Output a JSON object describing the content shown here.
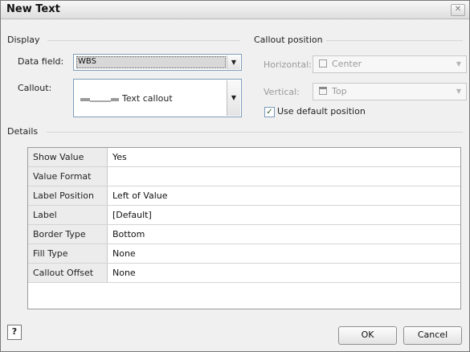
{
  "window": {
    "title": "New Text",
    "close_glyph": "✕"
  },
  "display": {
    "section_label": "Display",
    "data_field_label": "Data field:",
    "data_field_value": "WBS",
    "callout_label": "Callout:",
    "callout_value": "Text callout"
  },
  "callout_position": {
    "section_label": "Callout position",
    "horizontal_label": "Horizontal:",
    "horizontal_value": "Center",
    "vertical_label": "Vertical:",
    "vertical_value": "Top",
    "use_default_label": "Use default position",
    "use_default_checked": true
  },
  "details": {
    "section_label": "Details",
    "rows": [
      {
        "key": "Show Value",
        "value": "Yes"
      },
      {
        "key": "Value Format",
        "value": ""
      },
      {
        "key": "Label Position",
        "value": "Left of Value"
      },
      {
        "key": "Label",
        "value": "[Default]"
      },
      {
        "key": "Border Type",
        "value": "Bottom"
      },
      {
        "key": "Fill Type",
        "value": "None"
      },
      {
        "key": "Callout Offset",
        "value": "None"
      }
    ]
  },
  "footer": {
    "help_glyph": "?",
    "ok_label": "OK",
    "cancel_label": "Cancel"
  },
  "icons": {
    "dropdown": "chevron-down-icon",
    "check": "checkmark-icon"
  }
}
